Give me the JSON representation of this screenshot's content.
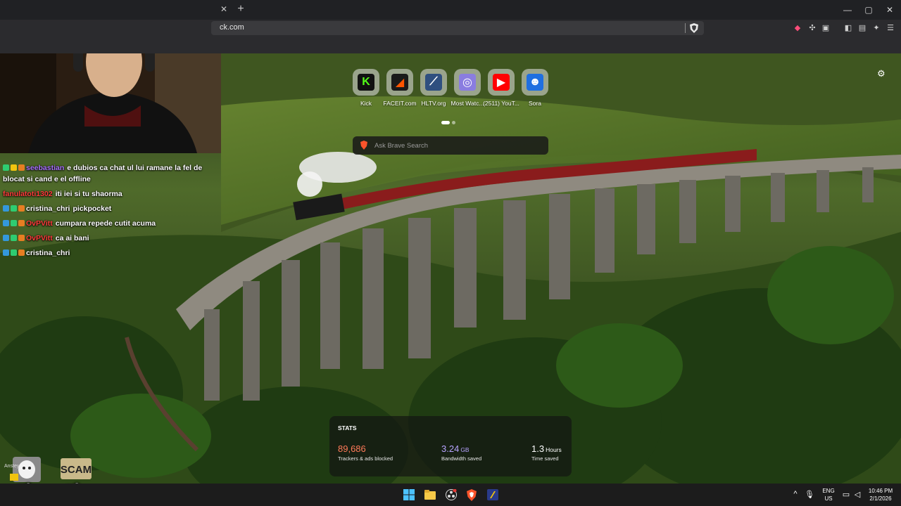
{
  "browser": {
    "url": "ck.com",
    "window_controls": [
      "—",
      "▢",
      "✕"
    ]
  },
  "top_sites": [
    {
      "label": "Kick",
      "icon": "kick-icon",
      "color": "#53fc18",
      "bg": "#111111",
      "glyph": "K"
    },
    {
      "label": "FACEIT.com",
      "icon": "faceit-icon",
      "color": "#ff5500",
      "bg": "#1a1a1a",
      "glyph": "◢"
    },
    {
      "label": "HLTV.org",
      "icon": "hltv-icon",
      "color": "#ffffff",
      "bg": "#2f4f7f",
      "glyph": "⟋"
    },
    {
      "label": "Most Watc...",
      "icon": "sphere-icon",
      "color": "#ffffff",
      "bg": "#8a7de0",
      "glyph": "◎"
    },
    {
      "label": "(2511) YouT...",
      "icon": "youtube-icon",
      "color": "#ffffff",
      "bg": "#ff0000",
      "glyph": "▶"
    },
    {
      "label": "Sora",
      "icon": "sora-icon",
      "color": "#ffffff",
      "bg": "#1f6fe0",
      "glyph": "☻"
    }
  ],
  "search": {
    "placeholder": "Ask Brave Search"
  },
  "chat": [
    {
      "user": "seebastian",
      "user_color": "#a970ff",
      "text": "e dubios ca chat ul lui ramane la fel de blocat si cand e el offline",
      "wrap": true,
      "badges": [
        "#2ecc71",
        "#f1c40f",
        "#e67e22"
      ]
    },
    {
      "user": "fanulatoti1302",
      "user_color": "#ff3b3b",
      "text": "iti iei si tu shaorma",
      "wrap": false,
      "badges": []
    },
    {
      "user": "cristina_chri",
      "user_color": "#ffffff",
      "text": "pickpocket",
      "wrap": false,
      "badges": [
        "#3498db",
        "#2ecc71",
        "#e67e22"
      ]
    },
    {
      "user": "OvPVitt",
      "user_color": "#ff3b3b",
      "text": "cumpara repede cutit acuma",
      "wrap": false,
      "badges": [
        "#3498db",
        "#2ecc71",
        "#e67e22"
      ]
    },
    {
      "user": "OvPVitt",
      "user_color": "#ff3b3b",
      "text": "ca ai bani",
      "wrap": false,
      "badges": [
        "#3498db",
        "#2ecc71",
        "#e67e22"
      ]
    },
    {
      "user": "cristina_chri",
      "user_color": "#ffffff",
      "text": "",
      "wrap": false,
      "badges": [
        "#3498db",
        "#2ecc71",
        "#e67e22"
      ]
    }
  ],
  "stats": {
    "title": "STATS",
    "items": [
      {
        "value": "89,686",
        "unit": "",
        "label": "Trackers & ads blocked",
        "color": "#ff7a59"
      },
      {
        "value": "3.24",
        "unit": "GB",
        "label": "Bandwidth saved",
        "color": "#b7a3ff"
      },
      {
        "value": "1.3",
        "unit": "Hours",
        "label": "Time saved",
        "color": "#ffffff"
      }
    ]
  },
  "alerts": [
    {
      "count": "x3",
      "name": "Anstey",
      "icon": "cat-emote-icon"
    },
    {
      "count": "x3",
      "name": "",
      "icon": "scam-emote-icon",
      "text": "SCAM"
    }
  ],
  "taskbar": {
    "language": "ENG",
    "region": "US",
    "time": "10:46 PM",
    "date": "2/1/2026",
    "tray_arrow": "^"
  }
}
